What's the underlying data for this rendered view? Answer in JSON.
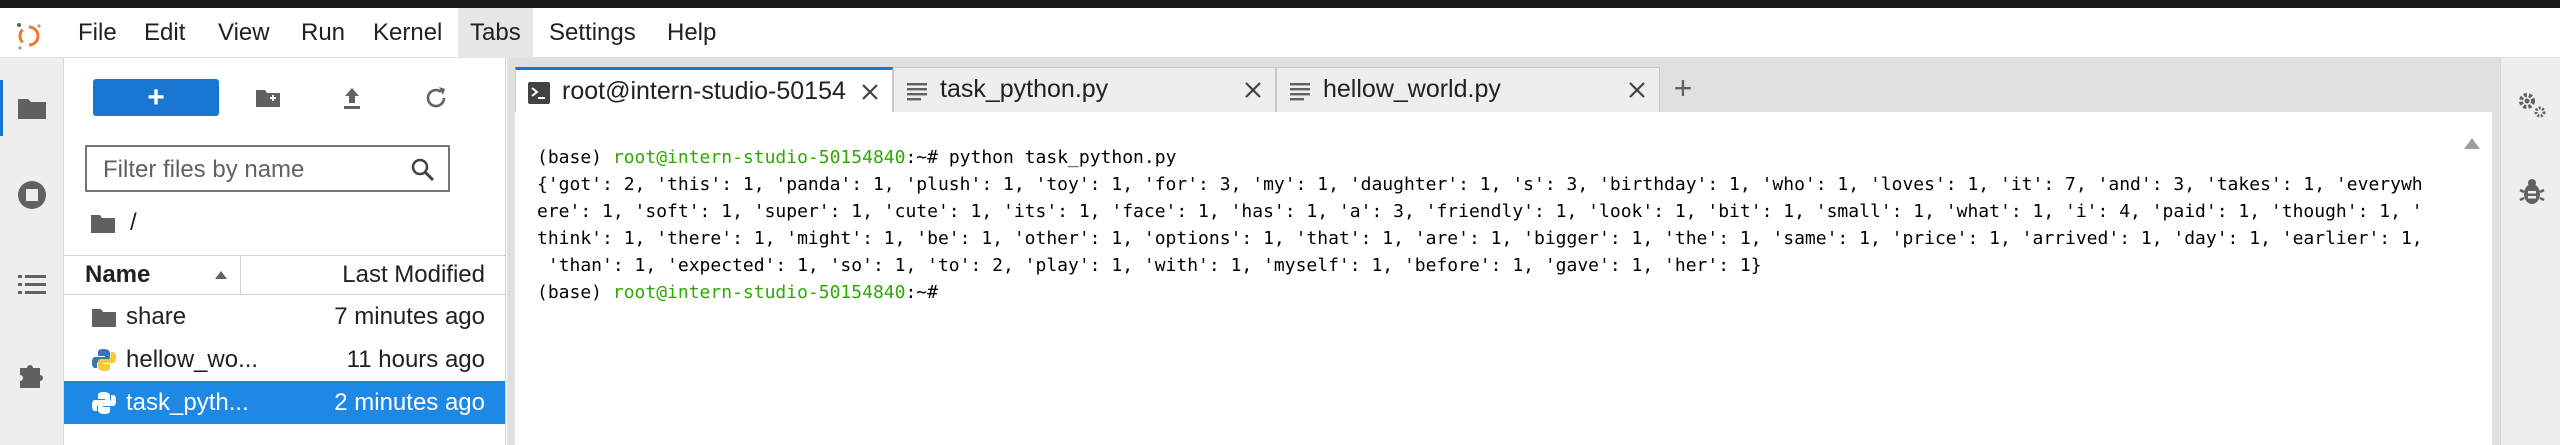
{
  "menu": {
    "items": [
      "File",
      "Edit",
      "View",
      "Run",
      "Kernel",
      "Tabs",
      "Settings",
      "Help"
    ],
    "active": "Tabs"
  },
  "left_sidebar": {
    "icons": [
      "folder-icon",
      "running-icon",
      "toc-icon",
      "extension-icon"
    ]
  },
  "file_browser": {
    "new_button_label": "+",
    "filter_placeholder": "Filter files by name",
    "breadcrumb": "/",
    "columns": {
      "name": "Name",
      "modified": "Last Modified"
    },
    "files": [
      {
        "name": "share",
        "modified": "7 minutes ago",
        "icon": "folder-icon",
        "selected": false
      },
      {
        "name": "hellow_wo...",
        "modified": "11 hours ago",
        "icon": "python-icon",
        "selected": false
      },
      {
        "name": "task_pyth...",
        "modified": "2 minutes ago",
        "icon": "python-icon",
        "selected": true
      }
    ]
  },
  "tabs": [
    {
      "label": "root@intern-studio-50154",
      "icon": "terminal-icon",
      "active": true
    },
    {
      "label": "task_python.py",
      "icon": "text-file-icon",
      "active": false
    },
    {
      "label": "hellow_world.py",
      "icon": "text-file-icon",
      "active": false
    }
  ],
  "add_tab_label": "+",
  "terminal": {
    "prompt_env": "(base) ",
    "prompt_user": "root@intern-studio-50154840",
    "prompt_suffix": ":~# ",
    "command": "python task_python.py",
    "output_lines": [
      "{'got': 2, 'this': 1, 'panda': 1, 'plush': 1, 'toy': 1, 'for': 3, 'my': 1, 'daughter': 1, 's': 3, 'birthday': 1, 'who': 1, 'loves': 1, 'it': 7, 'and': 3, 'takes': 1, 'everywh",
      "ere': 1, 'soft': 1, 'super': 1, 'cute': 1, 'its': 1, 'face': 1, 'has': 1, 'a': 3, 'friendly': 1, 'look': 1, 'bit': 1, 'small': 1, 'what': 1, 'i': 4, 'paid': 1, 'though': 1, '",
      "think': 1, 'there': 1, 'might': 1, 'be': 1, 'other': 1, 'options': 1, 'that': 1, 'are': 1, 'bigger': 1, 'the': 1, 'same': 1, 'price': 1, 'arrived': 1, 'day': 1, 'earlier': 1,",
      " 'than': 1, 'expected': 1, 'so': 1, 'to': 2, 'play': 1, 'with': 1, 'myself': 1, 'before': 1, 'gave': 1, 'her': 1}"
    ]
  },
  "right_sidebar": {
    "icons": [
      "property-inspector-icon",
      "debugger-icon"
    ]
  },
  "colors": {
    "accent": "#1976d2",
    "selected_row": "#1e88e5",
    "prompt_green": "#2fa800"
  }
}
